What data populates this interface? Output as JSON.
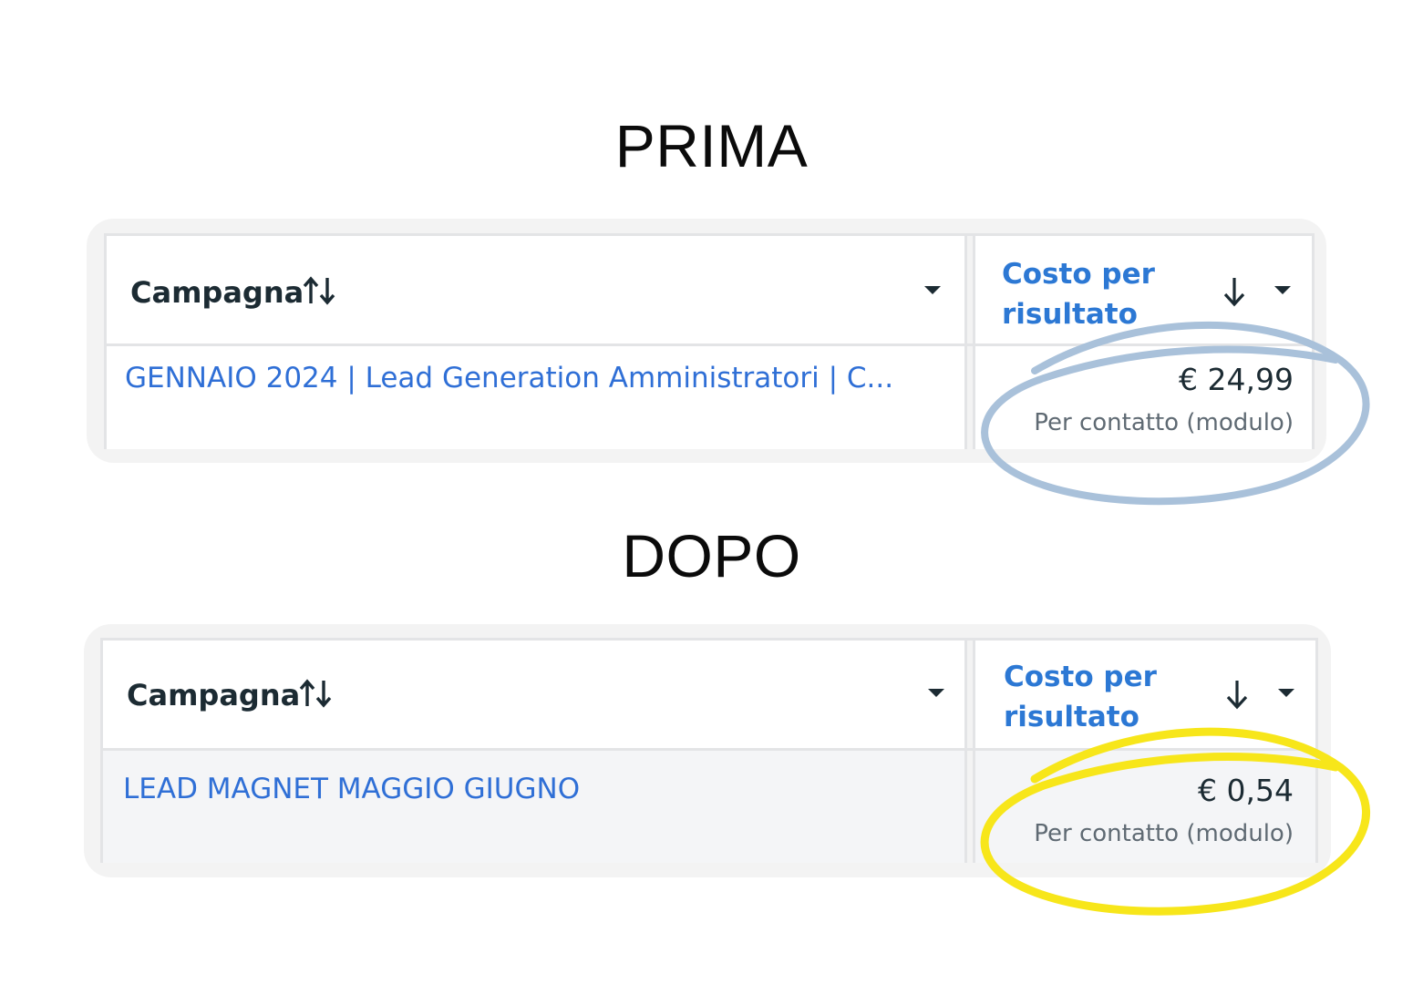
{
  "headings": {
    "before": "PRIMA",
    "after": "DOPO"
  },
  "tables": {
    "before": {
      "column_campaign": "Campagna",
      "column_cost": "Costo per risultato",
      "row": {
        "campaign_name": "GENNAIO 2024 | Lead Generation Amministratori | C...",
        "cost_value": "€ 24,99",
        "cost_unit": "Per contatto (modulo)"
      },
      "highlight_color": "#a9c1da"
    },
    "after": {
      "column_campaign": "Campagna",
      "column_cost": "Costo per risultato",
      "row": {
        "campaign_name": "LEAD MAGNET MAGGIO GIUGNO",
        "cost_value": "€ 0,54",
        "cost_unit": "Per contatto (modulo)"
      },
      "highlight_color": "#f7e61a"
    }
  },
  "colors": {
    "link": "#2f6fd6",
    "header_text": "#1c2b33",
    "panel_bg": "#f3f3f3"
  },
  "icons": [
    "sort-updown-icon",
    "caret-down-icon",
    "arrow-down-icon"
  ]
}
